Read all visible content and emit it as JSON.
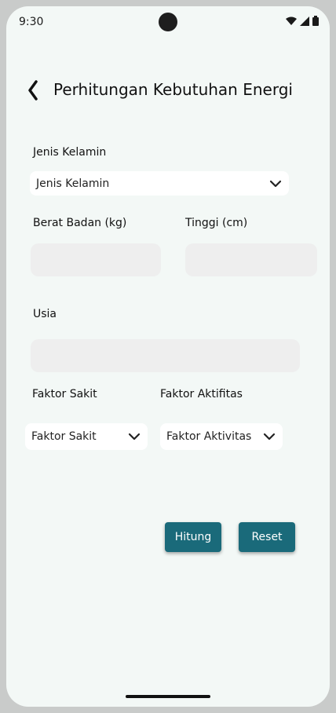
{
  "status": {
    "time": "9:30",
    "icons": [
      "wifi-icon",
      "signal-icon",
      "battery-icon"
    ]
  },
  "header": {
    "title": "Perhitungan Kebutuhan Energi",
    "back_icon": "chevron-left-icon"
  },
  "form": {
    "gender_label": "Jenis Kelamin",
    "gender_value": "Jenis Kelamin",
    "weight_label": "Berat Badan (kg)",
    "height_label": "Tinggi (cm)",
    "age_label": "Usia",
    "sick_label": "Faktor Sakit",
    "sick_value": "Faktor Sakit",
    "activity_label": "Faktor Aktifitas",
    "activity_value": "Faktor Aktivitas",
    "weight_value": "",
    "height_value": "",
    "age_value": ""
  },
  "actions": {
    "calculate_label": "Hitung",
    "reset_label": "Reset"
  },
  "colors": {
    "primary": "#1a6a7a",
    "background": "#f3f8f6",
    "input_bg": "#eeeeee"
  }
}
